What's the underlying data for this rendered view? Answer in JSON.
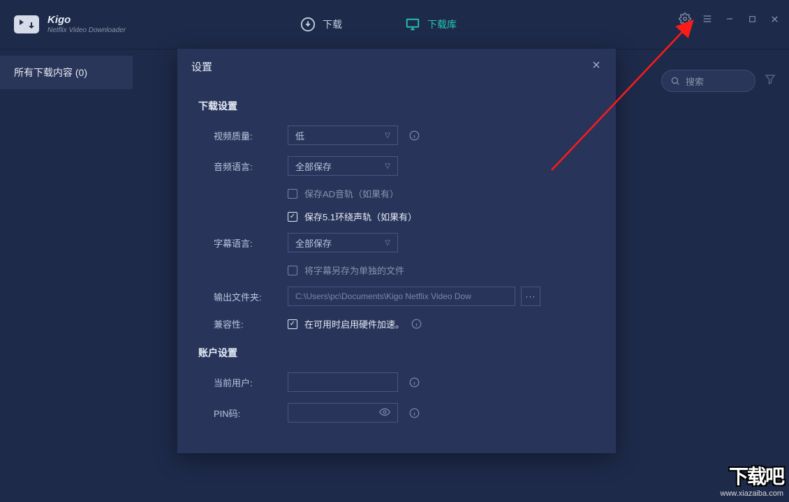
{
  "brand": {
    "name": "Kigo",
    "sub": "Netflix Video Downloader"
  },
  "tabs": {
    "download": "下载",
    "library": "下载库"
  },
  "sidebar": {
    "all_downloads": "所有下载内容 (0)"
  },
  "search": {
    "placeholder": "搜索"
  },
  "dialog": {
    "title": "设置",
    "section_download": "下载设置",
    "section_account": "账户设置",
    "video_quality_label": "视频质量:",
    "video_quality_value": "低",
    "audio_lang_label": "音频语言:",
    "audio_lang_value": "全部保存",
    "save_ad_audio": "保存AD音轨（如果有）",
    "save_51_audio": "保存5.1环绕声轨（如果有）",
    "subtitle_lang_label": "字幕语言:",
    "subtitle_lang_value": "全部保存",
    "save_sub_separately": "将字幕另存为单独的文件",
    "output_folder_label": "输出文件夹:",
    "output_folder_value": "C:\\Users\\pc\\Documents\\Kigo Netflix Video Dow",
    "browse": "···",
    "compat_label": "兼容性:",
    "compat_text": "在可用时启用硬件加速。",
    "current_user_label": "当前用户:",
    "pin_label": "PIN码:"
  },
  "watermark": {
    "big": "下载吧",
    "url": "www.xiazaiba.com"
  }
}
